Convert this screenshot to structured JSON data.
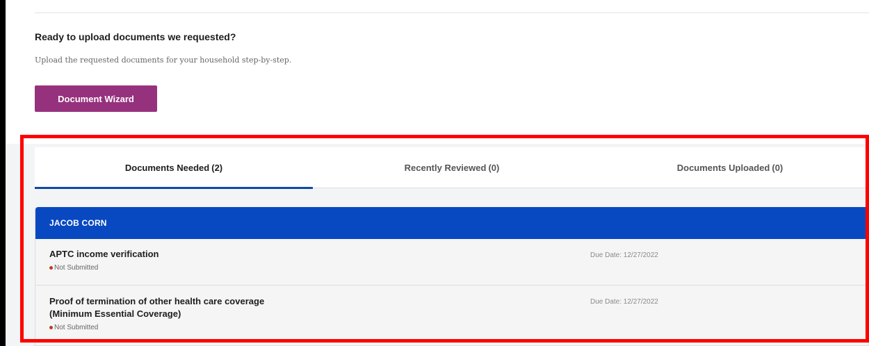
{
  "upload": {
    "heading": "Ready to upload documents we requested?",
    "description": "Upload the requested documents for your household step-by-step.",
    "wizard_button": "Document Wizard"
  },
  "tabs": [
    {
      "label": "Documents Needed",
      "count": "(2)",
      "active": true
    },
    {
      "label": "Recently Reviewed",
      "count": "(0)",
      "active": false
    },
    {
      "label": "Documents Uploaded",
      "count": "(0)",
      "active": false
    }
  ],
  "person": {
    "name": "JACOB CORN",
    "documents": [
      {
        "title_line1": "APTC income verification",
        "title_line2": "",
        "status": "Not Submitted",
        "due_date": "Due Date: 12/27/2022"
      },
      {
        "title_line1": "Proof of termination of other health care coverage",
        "title_line2": "(Minimum Essential Coverage)",
        "status": "Not Submitted",
        "due_date": "Due Date: 12/27/2022"
      }
    ]
  },
  "colors": {
    "wizard_button_bg": "#96317d",
    "person_header_bg": "#0849c2",
    "active_tab_underline": "#0d4aa6",
    "highlight_border": "#ff0000",
    "status_dot": "#c0392b"
  }
}
